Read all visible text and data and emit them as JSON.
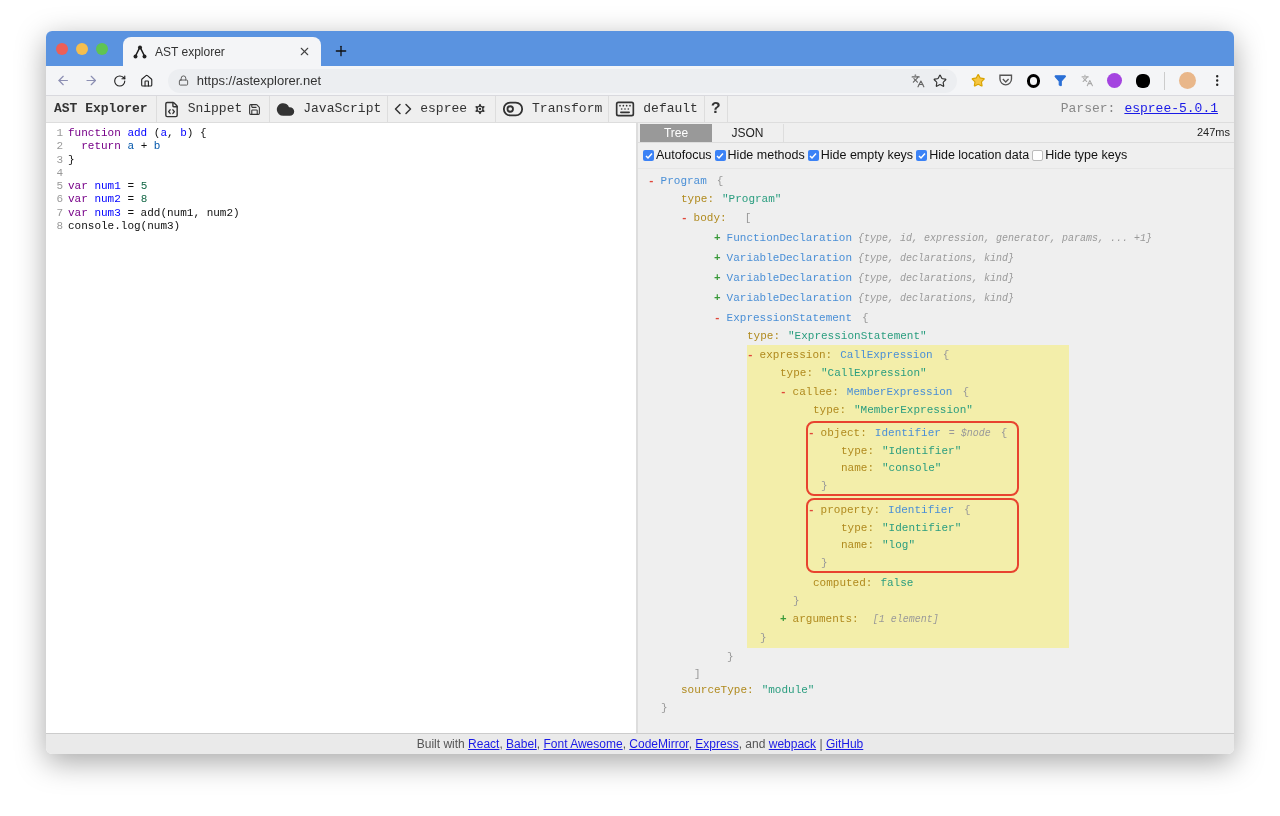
{
  "browser": {
    "tab": {
      "title": "AST explorer"
    },
    "url": "https://astexplorer.net"
  },
  "toolbar": {
    "brand": "AST Explorer",
    "items": [
      {
        "kind": "snippet",
        "label": "Snippet"
      },
      {
        "kind": "language",
        "label": "JavaScript"
      },
      {
        "kind": "parser",
        "label": "espree"
      },
      {
        "kind": "transform",
        "label": "Transform"
      },
      {
        "kind": "keymap",
        "label": "default"
      },
      {
        "kind": "help",
        "label": "?"
      }
    ],
    "parser_label": "Parser:",
    "parser_link": "espree-5.0.1"
  },
  "editor": {
    "lines": [
      {
        "number": "1",
        "tokens": [
          {
            "text": "function ",
            "kind": "keyword"
          },
          {
            "text": "add",
            "kind": "def"
          },
          {
            "text": " ("
          },
          {
            "text": "a",
            "kind": "def"
          },
          {
            "text": ", "
          },
          {
            "text": "b",
            "kind": "def"
          },
          {
            "text": ") {"
          }
        ]
      },
      {
        "number": "2",
        "tokens": [
          {
            "text": "  return ",
            "kind": "keyword"
          },
          {
            "text": "a",
            "kind": "var2"
          },
          {
            "text": " + "
          },
          {
            "text": "b",
            "kind": "var2"
          }
        ]
      },
      {
        "number": "3",
        "tokens": [
          {
            "text": "}"
          }
        ]
      },
      {
        "number": "4"
      },
      {
        "number": "5",
        "tokens": [
          {
            "text": "var ",
            "kind": "keyword"
          },
          {
            "text": "num1",
            "kind": "def"
          },
          {
            "text": " = "
          },
          {
            "text": "5",
            "kind": "number"
          }
        ]
      },
      {
        "number": "6",
        "tokens": [
          {
            "text": "var ",
            "kind": "keyword"
          },
          {
            "text": "num2",
            "kind": "def"
          },
          {
            "text": " = "
          },
          {
            "text": "8",
            "kind": "number"
          }
        ]
      },
      {
        "number": "7",
        "tokens": [
          {
            "text": "var ",
            "kind": "keyword"
          },
          {
            "text": "num3",
            "kind": "def"
          },
          {
            "text": " = add(num1, num2)"
          }
        ]
      },
      {
        "number": "8",
        "tokens": [
          {
            "text": "console.log(num3)"
          }
        ]
      }
    ]
  },
  "output": {
    "tabs": [
      {
        "label": "Tree",
        "selected": true
      },
      {
        "label": "JSON",
        "selected": false
      }
    ],
    "timing": "247ms",
    "options": [
      {
        "label": "Autofocus",
        "checked": true
      },
      {
        "label": "Hide methods",
        "checked": true
      },
      {
        "label": "Hide empty keys",
        "checked": true
      },
      {
        "label": "Hide location data",
        "checked": true
      },
      {
        "label": "Hide type keys",
        "checked": false
      }
    ],
    "tree": [
      {
        "kind": "object",
        "toggle": "-",
        "expanded": true,
        "name": "Program",
        "open": "{",
        "close": "}",
        "children": [
          {
            "kind": "prop",
            "key": "type:",
            "value": "\"Program\""
          },
          {
            "kind": "array",
            "toggle": "-",
            "expanded": true,
            "key": "body:",
            "open": "[",
            "close": "]",
            "children": [
              {
                "kind": "object",
                "toggle": "+",
                "expanded": false,
                "name": "FunctionDeclaration",
                "summary": "{type, id, expression, generator, params, ... +1}"
              },
              {
                "kind": "object",
                "toggle": "+",
                "expanded": false,
                "name": "VariableDeclaration",
                "summary": "{type, declarations, kind}"
              },
              {
                "kind": "object",
                "toggle": "+",
                "expanded": false,
                "name": "VariableDeclaration",
                "summary": "{type, declarations, kind}"
              },
              {
                "kind": "object",
                "toggle": "+",
                "expanded": false,
                "name": "VariableDeclaration",
                "summary": "{type, declarations, kind}"
              },
              {
                "kind": "object",
                "toggle": "-",
                "expanded": true,
                "name": "ExpressionStatement",
                "open": "{",
                "close": "}",
                "children": [
                  {
                    "kind": "prop",
                    "key": "type:",
                    "value": "\"ExpressionStatement\""
                  },
                  {
                    "kind": "object",
                    "toggle": "-",
                    "expanded": true,
                    "highlighted": true,
                    "key": "expression:",
                    "name": "CallExpression",
                    "open": "{",
                    "close": "}",
                    "children": [
                      {
                        "kind": "prop",
                        "key": "type:",
                        "value": "\"CallExpression\""
                      },
                      {
                        "kind": "object",
                        "toggle": "-",
                        "expanded": true,
                        "key": "callee:",
                        "name": "MemberExpression",
                        "open": "{",
                        "close": "}",
                        "children": [
                          {
                            "kind": "prop",
                            "key": "type:",
                            "value": "\"MemberExpression\""
                          },
                          {
                            "kind": "object",
                            "toggle": "-",
                            "expanded": true,
                            "outlined": true,
                            "key": "object:",
                            "name": "Identifier",
                            "annotation": "= $node",
                            "open": "{",
                            "close": "}",
                            "children": [
                              {
                                "kind": "prop",
                                "key": "type:",
                                "value": "\"Identifier\""
                              },
                              {
                                "kind": "prop",
                                "key": "name:",
                                "value": "\"console\""
                              }
                            ]
                          },
                          {
                            "kind": "object",
                            "toggle": "-",
                            "expanded": true,
                            "outlined": true,
                            "key": "property:",
                            "name": "Identifier",
                            "open": "{",
                            "close": "}",
                            "children": [
                              {
                                "kind": "prop",
                                "key": "type:",
                                "value": "\"Identifier\""
                              },
                              {
                                "kind": "prop",
                                "key": "name:",
                                "value": "\"log\""
                              }
                            ]
                          },
                          {
                            "kind": "prop",
                            "key": "computed:",
                            "value": "false"
                          }
                        ]
                      },
                      {
                        "kind": "array",
                        "toggle": "+",
                        "expanded": false,
                        "key": "arguments:",
                        "summary": "[1 element]"
                      }
                    ]
                  }
                ]
              }
            ]
          },
          {
            "kind": "prop",
            "key": "sourceType:",
            "value": "\"module\""
          }
        ]
      }
    ]
  },
  "footer": [
    {
      "kind": "text",
      "text": "Built with "
    },
    {
      "kind": "link",
      "text": "React"
    },
    {
      "kind": "text",
      "text": ", "
    },
    {
      "kind": "link",
      "text": "Babel"
    },
    {
      "kind": "text",
      "text": ", "
    },
    {
      "kind": "link",
      "text": "Font Awesome"
    },
    {
      "kind": "text",
      "text": ", "
    },
    {
      "kind": "link",
      "text": "CodeMirror"
    },
    {
      "kind": "text",
      "text": ", "
    },
    {
      "kind": "link",
      "text": "Express"
    },
    {
      "kind": "text",
      "text": ", and "
    },
    {
      "kind": "link",
      "text": "webpack"
    },
    {
      "kind": "text",
      "text": " | "
    },
    {
      "kind": "link",
      "text": "GitHub"
    }
  ]
}
